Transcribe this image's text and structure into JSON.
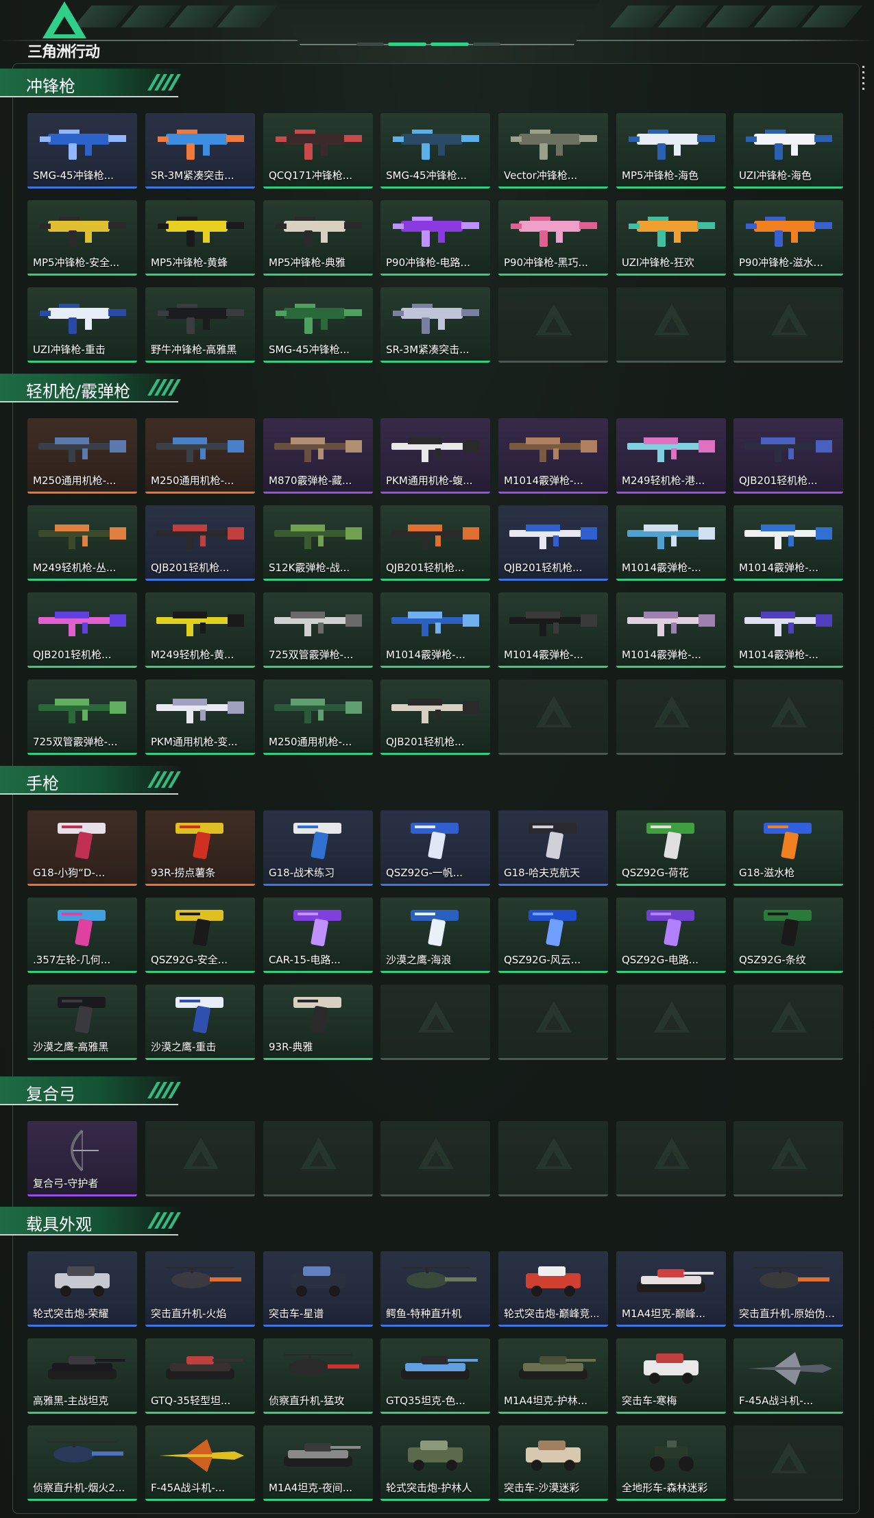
{
  "header": {
    "logo_text": "三角洲行动"
  },
  "colors": {
    "accent": "#2fd08a",
    "rarity_green": "#2fcf84",
    "rarity_blue": "#3b78e6",
    "rarity_purple": "#9a4ee6",
    "rarity_orange": "#f0722c"
  },
  "sections": [
    {
      "title": "冲锋枪",
      "items": [
        {
          "label": "SMG-45冲锋枪...",
          "rarity": "blue",
          "kind": "gun",
          "c1": "#2c63c8",
          "c2": "#8fb6ff"
        },
        {
          "label": "SR-3M紧凑突击...",
          "rarity": "blue",
          "kind": "gun",
          "c1": "#3d8de0",
          "c2": "#f07a3a"
        },
        {
          "label": "QCQ171冲锋枪...",
          "rarity": "green",
          "kind": "gun",
          "c1": "#3a2a2a",
          "c2": "#c84a4a"
        },
        {
          "label": "SMG-45冲锋枪...",
          "rarity": "green",
          "kind": "gun",
          "c1": "#2a4a66",
          "c2": "#5ab0e8"
        },
        {
          "label": "Vector冲锋枪...",
          "rarity": "green",
          "kind": "gun",
          "c1": "#6b7060",
          "c2": "#9aa08a"
        },
        {
          "label": "MP5冲锋枪-海色",
          "rarity": "green",
          "kind": "gun",
          "c1": "#e8eef5",
          "c2": "#2a60b0"
        },
        {
          "label": "UZI冲锋枪-海色",
          "rarity": "green",
          "kind": "gun",
          "c1": "#f2f4f8",
          "c2": "#2a60b0"
        },
        {
          "label": "MP5冲锋枪-安全...",
          "rarity": "green",
          "kind": "gun",
          "c1": "#e0c030",
          "c2": "#2a2a2a"
        },
        {
          "label": "MP5冲锋枪-黄蜂",
          "rarity": "green",
          "kind": "gun",
          "c1": "#e8d020",
          "c2": "#1a1a1a"
        },
        {
          "label": "MP5冲锋枪-典雅",
          "rarity": "green",
          "kind": "gun",
          "c1": "#d8d0c0",
          "c2": "#2a2a2a"
        },
        {
          "label": "P90冲锋枪-电路...",
          "rarity": "green",
          "kind": "gun",
          "c1": "#8a3ae0",
          "c2": "#c090ff"
        },
        {
          "label": "P90冲锋枪-黑巧...",
          "rarity": "green",
          "kind": "gun",
          "c1": "#f0a0c8",
          "c2": "#e06090"
        },
        {
          "label": "UZI冲锋枪-狂欢",
          "rarity": "green",
          "kind": "gun",
          "c1": "#f0a030",
          "c2": "#40c0a0"
        },
        {
          "label": "P90冲锋枪-滋水...",
          "rarity": "green",
          "kind": "gun",
          "c1": "#f08020",
          "c2": "#3a60d0"
        },
        {
          "label": "UZI冲锋枪-重击",
          "rarity": "green",
          "kind": "gun",
          "c1": "#e8eef8",
          "c2": "#2a4aa8"
        },
        {
          "label": "野牛冲锋枪-高雅黑",
          "rarity": "green",
          "kind": "gun",
          "c1": "#1a1c1e",
          "c2": "#3a3c3e"
        },
        {
          "label": "SMG-45冲锋枪...",
          "rarity": "green",
          "kind": "gun",
          "c1": "#2a6a3a",
          "c2": "#50a060"
        },
        {
          "label": "SR-3M紧凑突击...",
          "rarity": "green",
          "kind": "gun",
          "c1": "#c0c4d8",
          "c2": "#7a80a0"
        }
      ],
      "slots": 21
    },
    {
      "title": "轻机枪/霰弹枪",
      "items": [
        {
          "label": "M250通用机枪-...",
          "rarity": "orange",
          "kind": "rifle",
          "c1": "#3a3e48",
          "c2": "#5a7ab0"
        },
        {
          "label": "M250通用机枪-...",
          "rarity": "orange",
          "kind": "rifle",
          "c1": "#3a4048",
          "c2": "#4a80c8"
        },
        {
          "label": "M870霰弹枪-藏...",
          "rarity": "purple",
          "kind": "rifle",
          "c1": "#6a5040",
          "c2": "#b09070"
        },
        {
          "label": "PKM通用机枪-蝮...",
          "rarity": "purple",
          "kind": "rifle",
          "c1": "#e8e8e8",
          "c2": "#2a2a2a"
        },
        {
          "label": "M1014霰弹枪-...",
          "rarity": "purple",
          "kind": "rifle",
          "c1": "#7a5a40",
          "c2": "#b08060"
        },
        {
          "label": "M249轻机枪-港...",
          "rarity": "purple",
          "kind": "rifle",
          "c1": "#80d0e0",
          "c2": "#e070c0"
        },
        {
          "label": "QJB201轻机枪...",
          "rarity": "purple",
          "kind": "rifle",
          "c1": "#2a2e40",
          "c2": "#4a60c0"
        },
        {
          "label": "M249轻机枪-丛...",
          "rarity": "green",
          "kind": "rifle",
          "c1": "#3a4a2a",
          "c2": "#e08040"
        },
        {
          "label": "QJB201轻机枪...",
          "rarity": "blue",
          "kind": "rifle",
          "c1": "#2a2a2e",
          "c2": "#c04040"
        },
        {
          "label": "S12K霰弹枪-战...",
          "rarity": "green",
          "kind": "rifle",
          "c1": "#3a5a30",
          "c2": "#70a050"
        },
        {
          "label": "QJB201轻机枪...",
          "rarity": "green",
          "kind": "rifle",
          "c1": "#2a2a2a",
          "c2": "#e07030"
        },
        {
          "label": "QJB201轻机枪...",
          "rarity": "blue",
          "kind": "rifle",
          "c1": "#e8e8f0",
          "c2": "#3060d0"
        },
        {
          "label": "M1014霰弹枪-...",
          "rarity": "green",
          "kind": "rifle",
          "c1": "#50a0d0",
          "c2": "#d0e0f0"
        },
        {
          "label": "M1014霰弹枪-...",
          "rarity": "green",
          "kind": "rifle",
          "c1": "#f0f0f0",
          "c2": "#3070d0"
        },
        {
          "label": "QJB201轻机枪...",
          "rarity": "green",
          "kind": "rifle",
          "c1": "#e060d0",
          "c2": "#6040e0"
        },
        {
          "label": "M249轻机枪-黄...",
          "rarity": "green",
          "kind": "rifle",
          "c1": "#e0d020",
          "c2": "#1a1a1a"
        },
        {
          "label": "725双管霰弹枪-...",
          "rarity": "green",
          "kind": "rifle",
          "c1": "#d0d0d0",
          "c2": "#6a6a6a"
        },
        {
          "label": "M1014霰弹枪-...",
          "rarity": "green",
          "kind": "rifle",
          "c1": "#2a60c0",
          "c2": "#70b0f0"
        },
        {
          "label": "M1014霰弹枪-...",
          "rarity": "green",
          "kind": "rifle",
          "c1": "#1a1a1a",
          "c2": "#3a3a3a"
        },
        {
          "label": "M1014霰弹枪-...",
          "rarity": "green",
          "kind": "rifle",
          "c1": "#e0d0e0",
          "c2": "#a080b0"
        },
        {
          "label": "M1014霰弹枪-...",
          "rarity": "green",
          "kind": "rifle",
          "c1": "#e0e0f0",
          "c2": "#5040c0"
        },
        {
          "label": "725双管霰弹枪-...",
          "rarity": "green",
          "kind": "rifle",
          "c1": "#2a6a3a",
          "c2": "#60b060"
        },
        {
          "label": "PKM通用机枪-变...",
          "rarity": "green",
          "kind": "rifle",
          "c1": "#e8e8f0",
          "c2": "#a0a0c0"
        },
        {
          "label": "M250通用机枪-...",
          "rarity": "green",
          "kind": "rifle",
          "c1": "#2a5a3a",
          "c2": "#60a070"
        },
        {
          "label": "QJB201轻机枪...",
          "rarity": "green",
          "kind": "rifle",
          "c1": "#d8d0c0",
          "c2": "#2a2a2a"
        }
      ],
      "slots": 28
    },
    {
      "title": "手枪",
      "items": [
        {
          "label": "G18-小狗“D-...",
          "rarity": "orange",
          "kind": "pistol",
          "c1": "#e8e0e8",
          "c2": "#c03050"
        },
        {
          "label": "93R-捞点薯条",
          "rarity": "orange",
          "kind": "pistol",
          "c1": "#e0c020",
          "c2": "#d03020"
        },
        {
          "label": "G18-战术练习",
          "rarity": "blue",
          "kind": "pistol",
          "c1": "#e8e8e8",
          "c2": "#3070d0"
        },
        {
          "label": "QSZ92G-一帆...",
          "rarity": "blue",
          "kind": "pistol",
          "c1": "#3060d0",
          "c2": "#e0e8f8"
        },
        {
          "label": "G18-哈夫克航天",
          "rarity": "blue",
          "kind": "pistol",
          "c1": "#2a2a2e",
          "c2": "#d0d0d8"
        },
        {
          "label": "QSZ92G-荷花",
          "rarity": "green",
          "kind": "pistol",
          "c1": "#40a040",
          "c2": "#e0e0e0"
        },
        {
          "label": "G18-滋水枪",
          "rarity": "green",
          "kind": "pistol",
          "c1": "#3060e0",
          "c2": "#f08020"
        },
        {
          "label": ".357左轮-几何...",
          "rarity": "green",
          "kind": "pistol",
          "c1": "#40a0e0",
          "c2": "#e040a0"
        },
        {
          "label": "QSZ92G-安全...",
          "rarity": "green",
          "kind": "pistol",
          "c1": "#e0c020",
          "c2": "#1a1a1a"
        },
        {
          "label": "CAR-15-电路...",
          "rarity": "green",
          "kind": "pistol",
          "c1": "#8040e0",
          "c2": "#c090ff"
        },
        {
          "label": "沙漠之鹰-海浪",
          "rarity": "green",
          "kind": "pistol",
          "c1": "#2a60c0",
          "c2": "#e8f0f8"
        },
        {
          "label": "QSZ92G-风云...",
          "rarity": "green",
          "kind": "pistol",
          "c1": "#2050d0",
          "c2": "#70a0ff"
        },
        {
          "label": "QSZ92G-电路...",
          "rarity": "green",
          "kind": "pistol",
          "c1": "#7040d0",
          "c2": "#b080ff"
        },
        {
          "label": "QSZ92G-条纹",
          "rarity": "green",
          "kind": "pistol",
          "c1": "#2a7a3a",
          "c2": "#1a1a1a"
        },
        {
          "label": "沙漠之鹰-高雅黑",
          "rarity": "green",
          "kind": "pistol",
          "c1": "#1a1a1e",
          "c2": "#3a3a3e"
        },
        {
          "label": "沙漠之鹰-重击",
          "rarity": "green",
          "kind": "pistol",
          "c1": "#e8eef8",
          "c2": "#3050b0"
        },
        {
          "label": "93R-典雅",
          "rarity": "green",
          "kind": "pistol",
          "c1": "#d8d0c0",
          "c2": "#2a2a2a"
        }
      ],
      "slots": 21
    },
    {
      "title": "复合弓",
      "items": [
        {
          "label": "复合弓-守护者",
          "rarity": "purple",
          "kind": "bow",
          "c1": "#6a6a70",
          "c2": "#a0a0a8"
        }
      ],
      "slots": 7
    },
    {
      "title": "载具外观",
      "items": [
        {
          "label": "轮式突击炮-荣耀",
          "rarity": "blue",
          "kind": "vehicle",
          "c1": "#c8c8d0",
          "c2": "#4a4a50"
        },
        {
          "label": "突击直升机-火焰",
          "rarity": "blue",
          "kind": "heli",
          "c1": "#3a3a40",
          "c2": "#e07030"
        },
        {
          "label": "突击车-星谱",
          "rarity": "blue",
          "kind": "vehicle",
          "c1": "#2a3040",
          "c2": "#6080c0"
        },
        {
          "label": "鳄鱼-特种直升机",
          "rarity": "blue",
          "kind": "heli",
          "c1": "#3a4a3a",
          "c2": "#6a7a5a"
        },
        {
          "label": "轮式突击炮-巅峰竞...",
          "rarity": "blue",
          "kind": "vehicle",
          "c1": "#d04030",
          "c2": "#f0f0f0"
        },
        {
          "label": "M1A4坦克-巅峰...",
          "rarity": "blue",
          "kind": "tank",
          "c1": "#e8e0e0",
          "c2": "#d04040"
        },
        {
          "label": "突击直升机-原始伪...",
          "rarity": "blue",
          "kind": "heli",
          "c1": "#3a3a3a",
          "c2": "#e07030"
        },
        {
          "label": "高雅黑-主战坦克",
          "rarity": "green",
          "kind": "tank",
          "c1": "#1a1a1e",
          "c2": "#3a3a3e"
        },
        {
          "label": "GTQ-35轻型坦...",
          "rarity": "green",
          "kind": "tank",
          "c1": "#3a3030",
          "c2": "#c04040"
        },
        {
          "label": "侦察直升机-猛攻",
          "rarity": "green",
          "kind": "heli",
          "c1": "#2a2a2a",
          "c2": "#d03030"
        },
        {
          "label": "GTQ35坦克-色...",
          "rarity": "green",
          "kind": "tank",
          "c1": "#60a0e0",
          "c2": "#2a2a2a"
        },
        {
          "label": "M1A4坦克-护林...",
          "rarity": "green",
          "kind": "tank",
          "c1": "#6a7050",
          "c2": "#4a5038"
        },
        {
          "label": "突击车-寒梅",
          "rarity": "green",
          "kind": "vehicle",
          "c1": "#e8e8e8",
          "c2": "#c04040"
        },
        {
          "label": "F-45A战斗机-...",
          "rarity": "green",
          "kind": "jet",
          "c1": "#5a5e68",
          "c2": "#8a8e98"
        },
        {
          "label": "侦察直升机-烟火2...",
          "rarity": "green",
          "kind": "heli",
          "c1": "#2a3a5a",
          "c2": "#5070c0"
        },
        {
          "label": "F-45A战斗机-...",
          "rarity": "green",
          "kind": "jet",
          "c1": "#e0c020",
          "c2": "#d06020"
        },
        {
          "label": "M1A4坦克-夜间...",
          "rarity": "green",
          "kind": "tank",
          "c1": "#8a8a8a",
          "c2": "#3a3a3a"
        },
        {
          "label": "轮式突击炮-护林人",
          "rarity": "green",
          "kind": "vehicle",
          "c1": "#5a6a4a",
          "c2": "#8a9a7a"
        },
        {
          "label": "突击车-沙漠迷彩",
          "rarity": "green",
          "kind": "vehicle",
          "c1": "#d8c8b0",
          "c2": "#a08060"
        },
        {
          "label": "全地形车-森林迷彩",
          "rarity": "green",
          "kind": "atv",
          "c1": "#2a3a2a",
          "c2": "#4a5a4a"
        }
      ],
      "slots": 21
    }
  ]
}
